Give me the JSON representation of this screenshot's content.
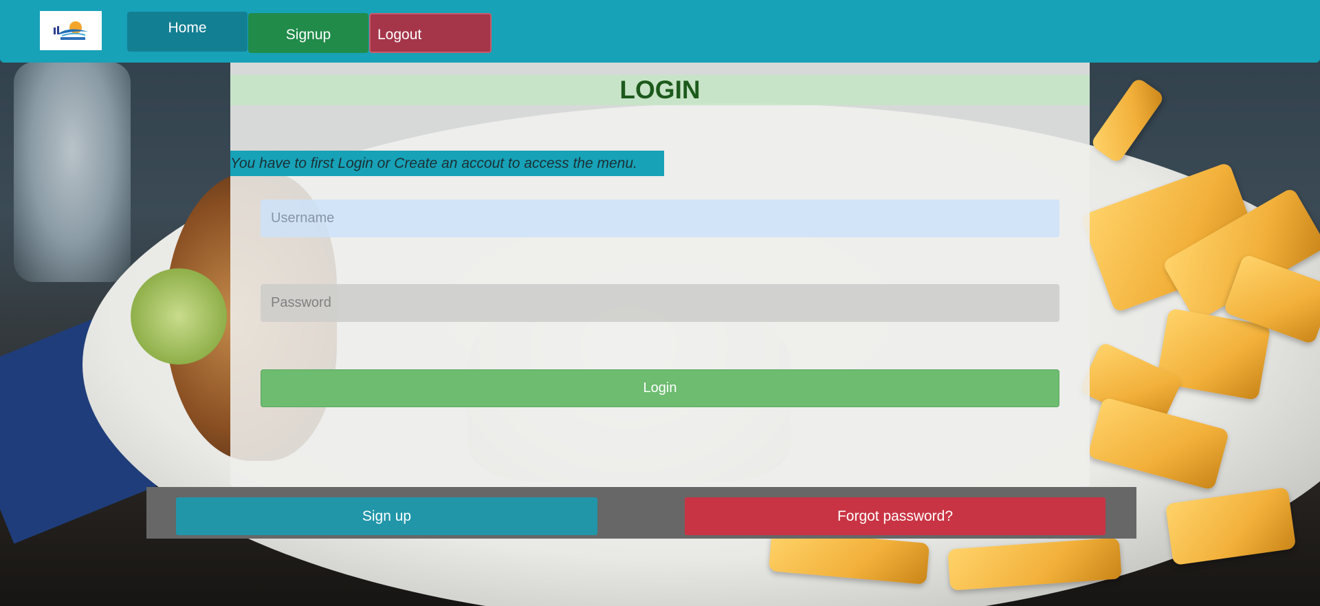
{
  "nav": {
    "home_label": "Home",
    "signup_label": "Signup",
    "logout_label": "Logout"
  },
  "login": {
    "title": "LOGIN",
    "notice": "You have to first Login or Create an accout to access the menu.",
    "username_placeholder": "Username",
    "password_placeholder": "Password",
    "submit_label": "Login"
  },
  "footer": {
    "signup_label": "Sign up",
    "forgot_label": "Forgot password?"
  },
  "colors": {
    "navbar": "#17a2b8",
    "success": "#218b4a",
    "danger": "#a5364a",
    "login_button": "#6dbc70"
  }
}
